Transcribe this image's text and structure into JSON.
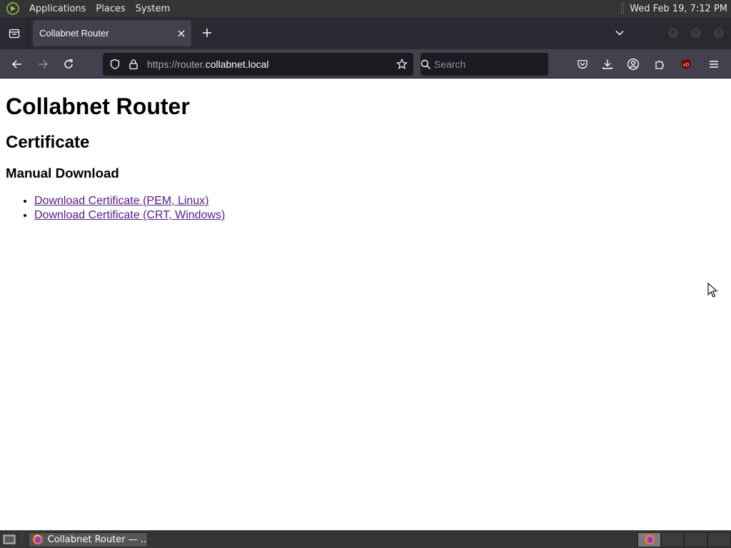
{
  "top_panel": {
    "menus": [
      "Applications",
      "Places",
      "System"
    ],
    "clock": "Wed Feb 19,  7:12 PM"
  },
  "browser": {
    "tab": {
      "title": "Collabnet Router",
      "close_glyph": "✕"
    },
    "urlbar": {
      "scheme_host_prefix": "https://router.",
      "host_domain": "collabnet.local"
    },
    "searchbar": {
      "placeholder": "Search"
    },
    "toolbar_icons": [
      "back-icon",
      "forward-icon",
      "reload-icon",
      "shield-icon",
      "lock-icon",
      "star-icon",
      "search-icon",
      "pocket-icon",
      "downloads-icon",
      "account-icon",
      "extensions-icon",
      "ublock-icon",
      "menu-icon"
    ],
    "ublock_label": "uD"
  },
  "page": {
    "h1": "Collabnet Router",
    "h2": "Certificate",
    "h3": "Manual Download",
    "links": [
      "Download Certificate (PEM, Linux)",
      "Download Certificate (CRT, Windows)"
    ]
  },
  "taskbar": {
    "window_title": "Collabnet Router — ..."
  },
  "colors": {
    "panel_bg": "#353535",
    "tabstrip_bg": "#2b2a33",
    "toolbar_bg": "#42414d",
    "field_bg": "#1c1b22",
    "link_visited": "#551a8b",
    "ublock_red": "#800000"
  }
}
